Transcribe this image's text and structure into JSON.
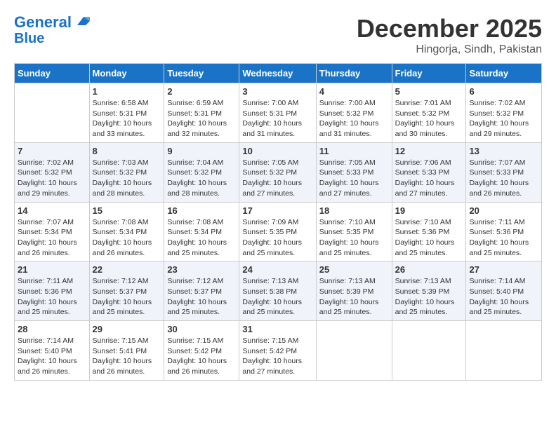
{
  "header": {
    "logo_line1": "General",
    "logo_line2": "Blue",
    "title": "December 2025",
    "subtitle": "Hingorja, Sindh, Pakistan"
  },
  "weekdays": [
    "Sunday",
    "Monday",
    "Tuesday",
    "Wednesday",
    "Thursday",
    "Friday",
    "Saturday"
  ],
  "weeks": [
    [
      {
        "day": "",
        "info": ""
      },
      {
        "day": "1",
        "info": "Sunrise: 6:58 AM\nSunset: 5:31 PM\nDaylight: 10 hours\nand 33 minutes."
      },
      {
        "day": "2",
        "info": "Sunrise: 6:59 AM\nSunset: 5:31 PM\nDaylight: 10 hours\nand 32 minutes."
      },
      {
        "day": "3",
        "info": "Sunrise: 7:00 AM\nSunset: 5:31 PM\nDaylight: 10 hours\nand 31 minutes."
      },
      {
        "day": "4",
        "info": "Sunrise: 7:00 AM\nSunset: 5:32 PM\nDaylight: 10 hours\nand 31 minutes."
      },
      {
        "day": "5",
        "info": "Sunrise: 7:01 AM\nSunset: 5:32 PM\nDaylight: 10 hours\nand 30 minutes."
      },
      {
        "day": "6",
        "info": "Sunrise: 7:02 AM\nSunset: 5:32 PM\nDaylight: 10 hours\nand 29 minutes."
      }
    ],
    [
      {
        "day": "7",
        "info": "Sunrise: 7:02 AM\nSunset: 5:32 PM\nDaylight: 10 hours\nand 29 minutes."
      },
      {
        "day": "8",
        "info": "Sunrise: 7:03 AM\nSunset: 5:32 PM\nDaylight: 10 hours\nand 28 minutes."
      },
      {
        "day": "9",
        "info": "Sunrise: 7:04 AM\nSunset: 5:32 PM\nDaylight: 10 hours\nand 28 minutes."
      },
      {
        "day": "10",
        "info": "Sunrise: 7:05 AM\nSunset: 5:32 PM\nDaylight: 10 hours\nand 27 minutes."
      },
      {
        "day": "11",
        "info": "Sunrise: 7:05 AM\nSunset: 5:33 PM\nDaylight: 10 hours\nand 27 minutes."
      },
      {
        "day": "12",
        "info": "Sunrise: 7:06 AM\nSunset: 5:33 PM\nDaylight: 10 hours\nand 27 minutes."
      },
      {
        "day": "13",
        "info": "Sunrise: 7:07 AM\nSunset: 5:33 PM\nDaylight: 10 hours\nand 26 minutes."
      }
    ],
    [
      {
        "day": "14",
        "info": "Sunrise: 7:07 AM\nSunset: 5:34 PM\nDaylight: 10 hours\nand 26 minutes."
      },
      {
        "day": "15",
        "info": "Sunrise: 7:08 AM\nSunset: 5:34 PM\nDaylight: 10 hours\nand 26 minutes."
      },
      {
        "day": "16",
        "info": "Sunrise: 7:08 AM\nSunset: 5:34 PM\nDaylight: 10 hours\nand 25 minutes."
      },
      {
        "day": "17",
        "info": "Sunrise: 7:09 AM\nSunset: 5:35 PM\nDaylight: 10 hours\nand 25 minutes."
      },
      {
        "day": "18",
        "info": "Sunrise: 7:10 AM\nSunset: 5:35 PM\nDaylight: 10 hours\nand 25 minutes."
      },
      {
        "day": "19",
        "info": "Sunrise: 7:10 AM\nSunset: 5:36 PM\nDaylight: 10 hours\nand 25 minutes."
      },
      {
        "day": "20",
        "info": "Sunrise: 7:11 AM\nSunset: 5:36 PM\nDaylight: 10 hours\nand 25 minutes."
      }
    ],
    [
      {
        "day": "21",
        "info": "Sunrise: 7:11 AM\nSunset: 5:36 PM\nDaylight: 10 hours\nand 25 minutes."
      },
      {
        "day": "22",
        "info": "Sunrise: 7:12 AM\nSunset: 5:37 PM\nDaylight: 10 hours\nand 25 minutes."
      },
      {
        "day": "23",
        "info": "Sunrise: 7:12 AM\nSunset: 5:37 PM\nDaylight: 10 hours\nand 25 minutes."
      },
      {
        "day": "24",
        "info": "Sunrise: 7:13 AM\nSunset: 5:38 PM\nDaylight: 10 hours\nand 25 minutes."
      },
      {
        "day": "25",
        "info": "Sunrise: 7:13 AM\nSunset: 5:39 PM\nDaylight: 10 hours\nand 25 minutes."
      },
      {
        "day": "26",
        "info": "Sunrise: 7:13 AM\nSunset: 5:39 PM\nDaylight: 10 hours\nand 25 minutes."
      },
      {
        "day": "27",
        "info": "Sunrise: 7:14 AM\nSunset: 5:40 PM\nDaylight: 10 hours\nand 25 minutes."
      }
    ],
    [
      {
        "day": "28",
        "info": "Sunrise: 7:14 AM\nSunset: 5:40 PM\nDaylight: 10 hours\nand 26 minutes."
      },
      {
        "day": "29",
        "info": "Sunrise: 7:15 AM\nSunset: 5:41 PM\nDaylight: 10 hours\nand 26 minutes."
      },
      {
        "day": "30",
        "info": "Sunrise: 7:15 AM\nSunset: 5:42 PM\nDaylight: 10 hours\nand 26 minutes."
      },
      {
        "day": "31",
        "info": "Sunrise: 7:15 AM\nSunset: 5:42 PM\nDaylight: 10 hours\nand 27 minutes."
      },
      {
        "day": "",
        "info": ""
      },
      {
        "day": "",
        "info": ""
      },
      {
        "day": "",
        "info": ""
      }
    ]
  ]
}
